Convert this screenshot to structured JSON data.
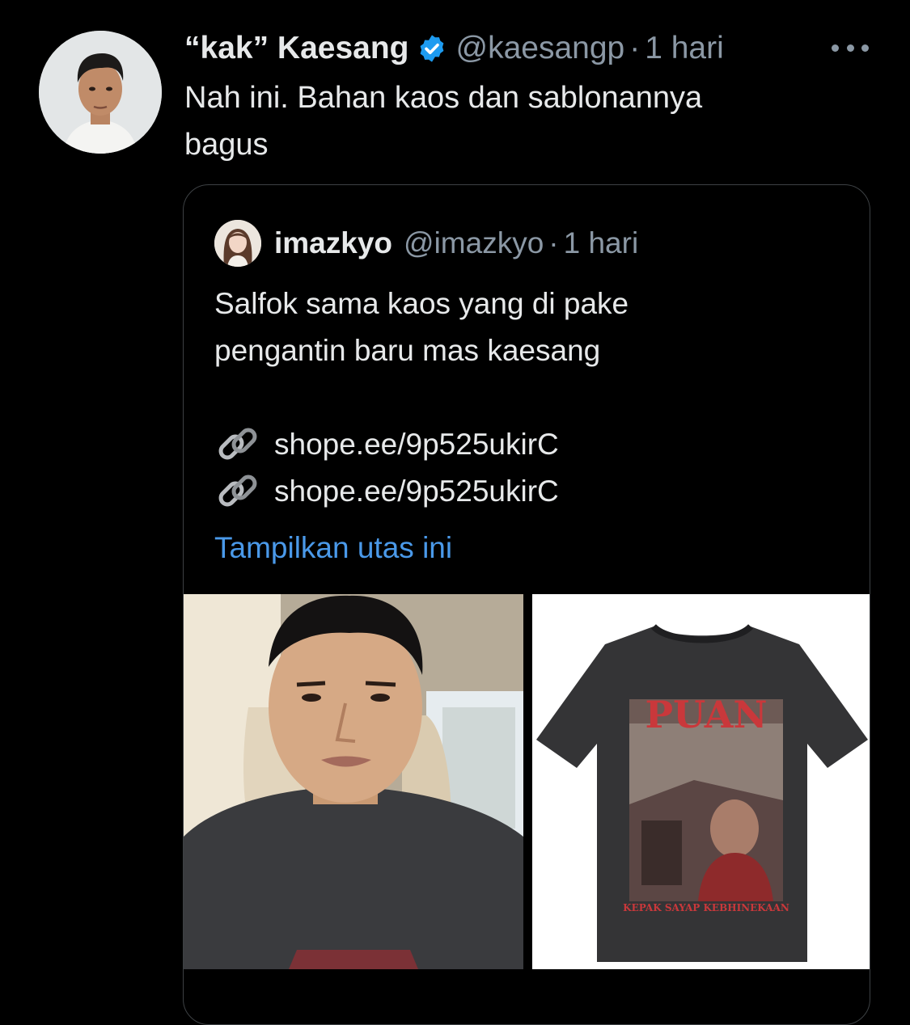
{
  "tweet": {
    "display_name": "“kak” Kaesang",
    "handle": "@kaesangp",
    "separator": "·",
    "time": "1 hari",
    "text": "Nah ini. Bahan kaos dan sablonannya\nbagus"
  },
  "quoted_tweet": {
    "display_name": "imazkyo",
    "handle": "@imazkyo",
    "separator": "·",
    "time": "1 hari",
    "text_lines": [
      "Salfok sama kaos yang di pake",
      "pengantin baru mas kaesang"
    ],
    "links": [
      "shope.ee/9p525ukirC",
      "shope.ee/9p525ukirC"
    ],
    "show_thread_label": "Tampilkan utas ini"
  },
  "media": {
    "left_image": "selfie-photo",
    "right_image": "tshirt-product-photo",
    "shirt_print_title": "PUAN",
    "shirt_print_caption": "KEPAK SAYAP KEBHINEKAAN"
  },
  "colors": {
    "background": "#000000",
    "text": "#e7e9ea",
    "muted": "#8b98a5",
    "link": "#4a99e9",
    "verified": "#1d9bf0",
    "border": "#3d4144"
  },
  "icons": [
    "verified-badge-icon",
    "more-options-icon",
    "link-chain-icon"
  ]
}
